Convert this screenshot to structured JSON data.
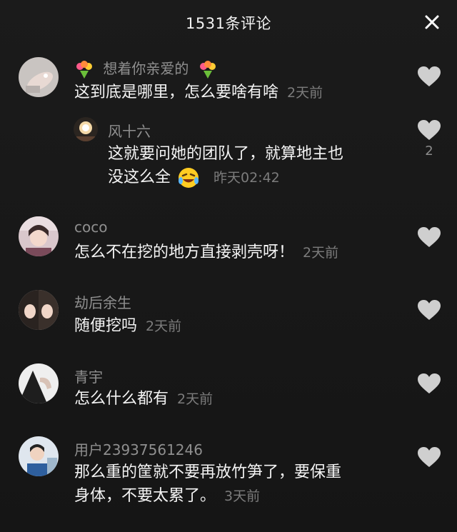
{
  "header": {
    "title": "1531条评论",
    "close_icon": "close-icon"
  },
  "comments": [
    {
      "username": "想着你亲爱的",
      "username_decor": "bouquet-emoji",
      "text": "这到底是哪里，怎么要啥有啥",
      "time": "2天前",
      "like_count": "",
      "reply": {
        "username": "风十六",
        "line1": "这就要问她的团队了，就算地主也",
        "line2": "没这么全",
        "emoji": "rofl-emoji",
        "time": "昨天02:42",
        "like_count": "2"
      }
    },
    {
      "username": "coco",
      "text": "怎么不在挖的地方直接剥壳呀！",
      "time": "2天前"
    },
    {
      "username": "劫后余生",
      "text": "随便挖吗",
      "time": "2天前"
    },
    {
      "username": "青宇",
      "text": "怎么什么都有",
      "time": "2天前"
    },
    {
      "username": "用户23937561246",
      "line1": "那么重的筐就不要再放竹笋了，要保重",
      "line2": "身体，不要太累了。",
      "time": "3天前"
    }
  ],
  "colors": {
    "background": "#161616",
    "text": "#f4f4f4",
    "meta": "#8f8f8f",
    "icon": "#cfcfcf"
  }
}
